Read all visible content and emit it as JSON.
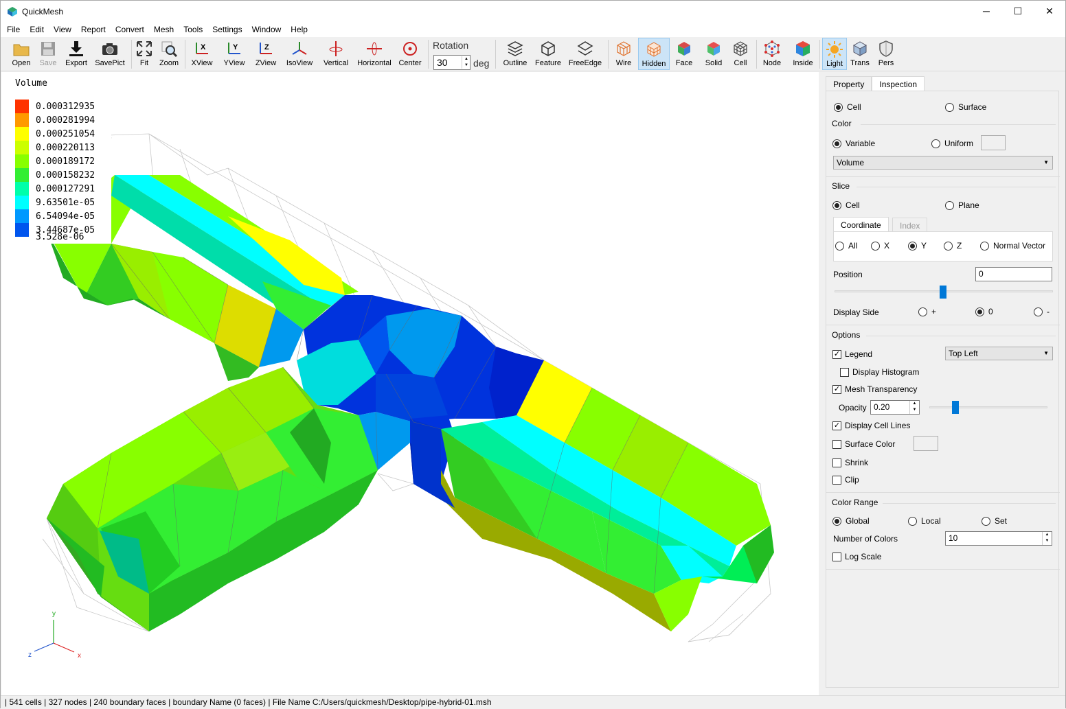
{
  "app": {
    "title": "QuickMesh"
  },
  "menu": [
    "File",
    "Edit",
    "View",
    "Report",
    "Convert",
    "Mesh",
    "Tools",
    "Settings",
    "Window",
    "Help"
  ],
  "toolbar": {
    "open": "Open",
    "save": "Save",
    "export": "Export",
    "savepict": "SavePict",
    "fit": "Fit",
    "zoom": "Zoom",
    "xview": "XView",
    "yview": "YView",
    "zview": "ZView",
    "isoview": "IsoView",
    "vertical": "Vertical",
    "horizontal": "Horizontal",
    "center": "Center",
    "rotation_label": "Rotation",
    "rotation_value": "30",
    "rotation_unit": "deg",
    "outline": "Outline",
    "feature": "Feature",
    "freeedge": "FreeEdge",
    "wire": "Wire",
    "hidden": "Hidden",
    "face": "Face",
    "solid": "Solid",
    "cell": "Cell",
    "node": "Node",
    "inside": "Inside",
    "light": "Light",
    "trans": "Trans",
    "pers": "Pers"
  },
  "legend": {
    "title": "Volume",
    "entries": [
      {
        "value": "0.000312935",
        "color": "#ff3300"
      },
      {
        "value": "0.000281994",
        "color": "#ff9900"
      },
      {
        "value": "0.000251054",
        "color": "#ffff00"
      },
      {
        "value": "0.000220113",
        "color": "#ccff00"
      },
      {
        "value": "0.000189172",
        "color": "#88ff00"
      },
      {
        "value": "0.000158232",
        "color": "#33ee33"
      },
      {
        "value": "0.000127291",
        "color": "#00ffaa"
      },
      {
        "value": "9.63501e-05",
        "color": "#00ffff"
      },
      {
        "value": "6.54094e-05",
        "color": "#0099ff"
      },
      {
        "value": "3.44687e-05",
        "color": "#0055ee"
      },
      {
        "value": "3.528e-06",
        "color": "#0022dd"
      }
    ]
  },
  "axes": {
    "x": "x",
    "y": "y",
    "z": "z"
  },
  "panel": {
    "tabs": [
      "Property",
      "Inspection"
    ],
    "mode": {
      "cell": "Cell",
      "surface": "Surface"
    },
    "color": {
      "label": "Color",
      "variable": "Variable",
      "uniform": "Uniform",
      "selected": "Volume"
    },
    "slice": {
      "label": "Slice",
      "cell": "Cell",
      "plane": "Plane",
      "subtabs": [
        "Coordinate",
        "Index"
      ],
      "axes": [
        "All",
        "X",
        "Y",
        "Z",
        "Normal Vector"
      ],
      "position_label": "Position",
      "position_value": "0",
      "display_side_label": "Display Side",
      "sides": [
        "+",
        "0",
        "-"
      ]
    },
    "options": {
      "label": "Options",
      "legend": "Legend",
      "legend_position": "Top Left",
      "display_histogram": "Display Histogram",
      "mesh_transparency": "Mesh Transparency",
      "opacity_label": "Opacity",
      "opacity_value": "0.20",
      "display_cell_lines": "Display Cell Lines",
      "surface_color": "Surface Color",
      "shrink": "Shrink",
      "clip": "Clip"
    },
    "color_range": {
      "label": "Color Range",
      "global": "Global",
      "local": "Local",
      "set": "Set",
      "num_colors_label": "Number of Colors",
      "num_colors_value": "10",
      "log_scale": "Log Scale"
    }
  },
  "status": "| 541 cells | 327 nodes | 240 boundary faces |  boundary Name  (0 faces) | File Name C:/Users/quickmesh/Desktop/pipe-hybrid-01.msh"
}
